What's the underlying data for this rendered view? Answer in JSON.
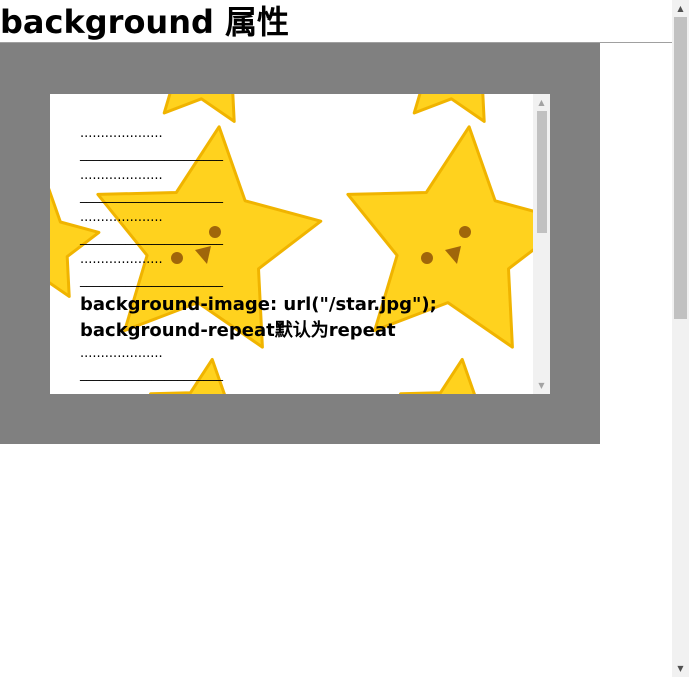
{
  "page": {
    "title": "background 属性"
  },
  "demo": {
    "background_image": "star-icon",
    "lines": [
      {
        "kind": "dots",
        "text": "...................."
      },
      {
        "kind": "rule",
        "text": "______________________"
      },
      {
        "kind": "dots",
        "text": "...................."
      },
      {
        "kind": "rule",
        "text": "______________________"
      },
      {
        "kind": "dots",
        "text": "...................."
      },
      {
        "kind": "rule",
        "text": "______________________"
      },
      {
        "kind": "dots",
        "text": "...................."
      },
      {
        "kind": "rule",
        "text": "______________________"
      },
      {
        "kind": "big",
        "text": "background-image: url(\"/star.jpg\");"
      },
      {
        "kind": "big",
        "text": "background-repeat默认为repeat"
      },
      {
        "kind": "dots",
        "text": "...................."
      },
      {
        "kind": "rule",
        "text": "______________________"
      }
    ]
  },
  "scrollbars": {
    "up_arrow": "▲",
    "down_arrow": "▼"
  },
  "colors": {
    "outer_box": "#808080",
    "inner_box": "#ffffff",
    "star_fill": "#ffd21e",
    "star_edge": "#f0b400",
    "star_face": "#a0660a"
  }
}
